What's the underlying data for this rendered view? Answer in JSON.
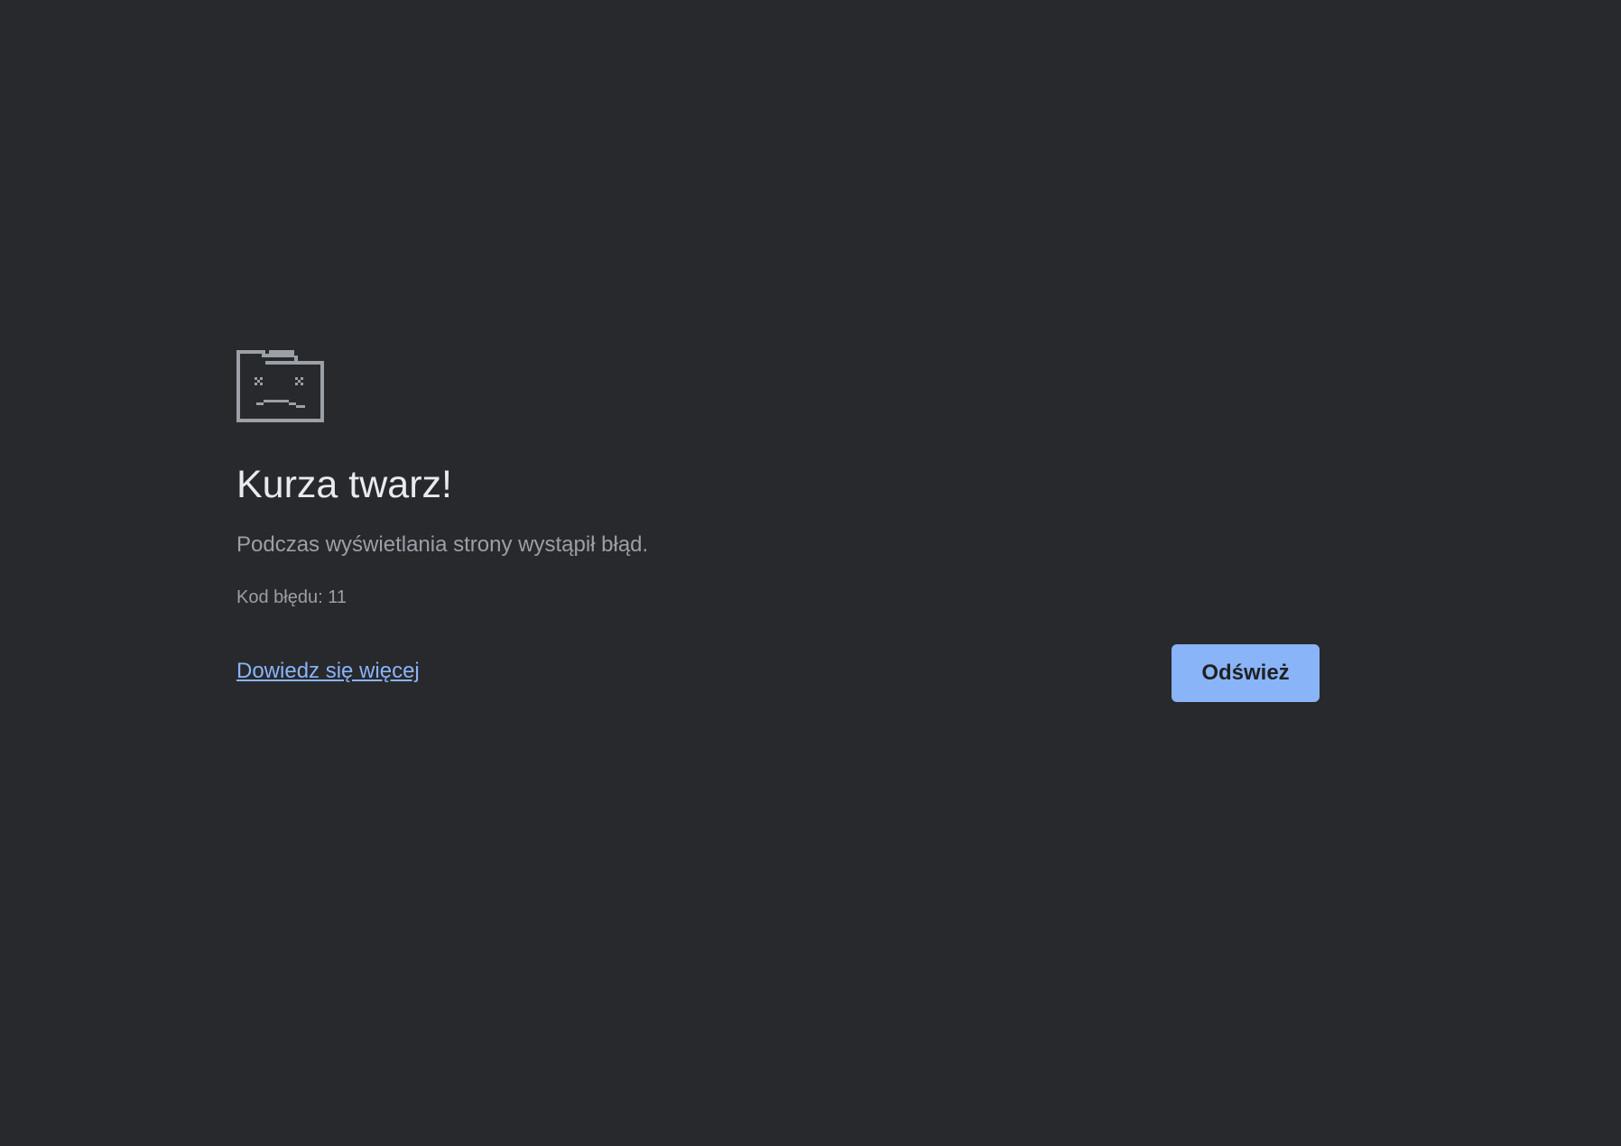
{
  "error_page": {
    "icon": "sad-tab-icon",
    "title": "Kurza twarz!",
    "message": "Podczas wyświetlania strony wystąpił błąd.",
    "error_code": "Kod błędu: 11",
    "learn_more_label": "Dowiedz się więcej",
    "reload_label": "Odśwież"
  },
  "colors": {
    "background": "#28292d",
    "title": "#e8eaed",
    "secondary_text": "#9aa0a6",
    "accent": "#8ab4f8",
    "icon": "#9aa0a6"
  }
}
